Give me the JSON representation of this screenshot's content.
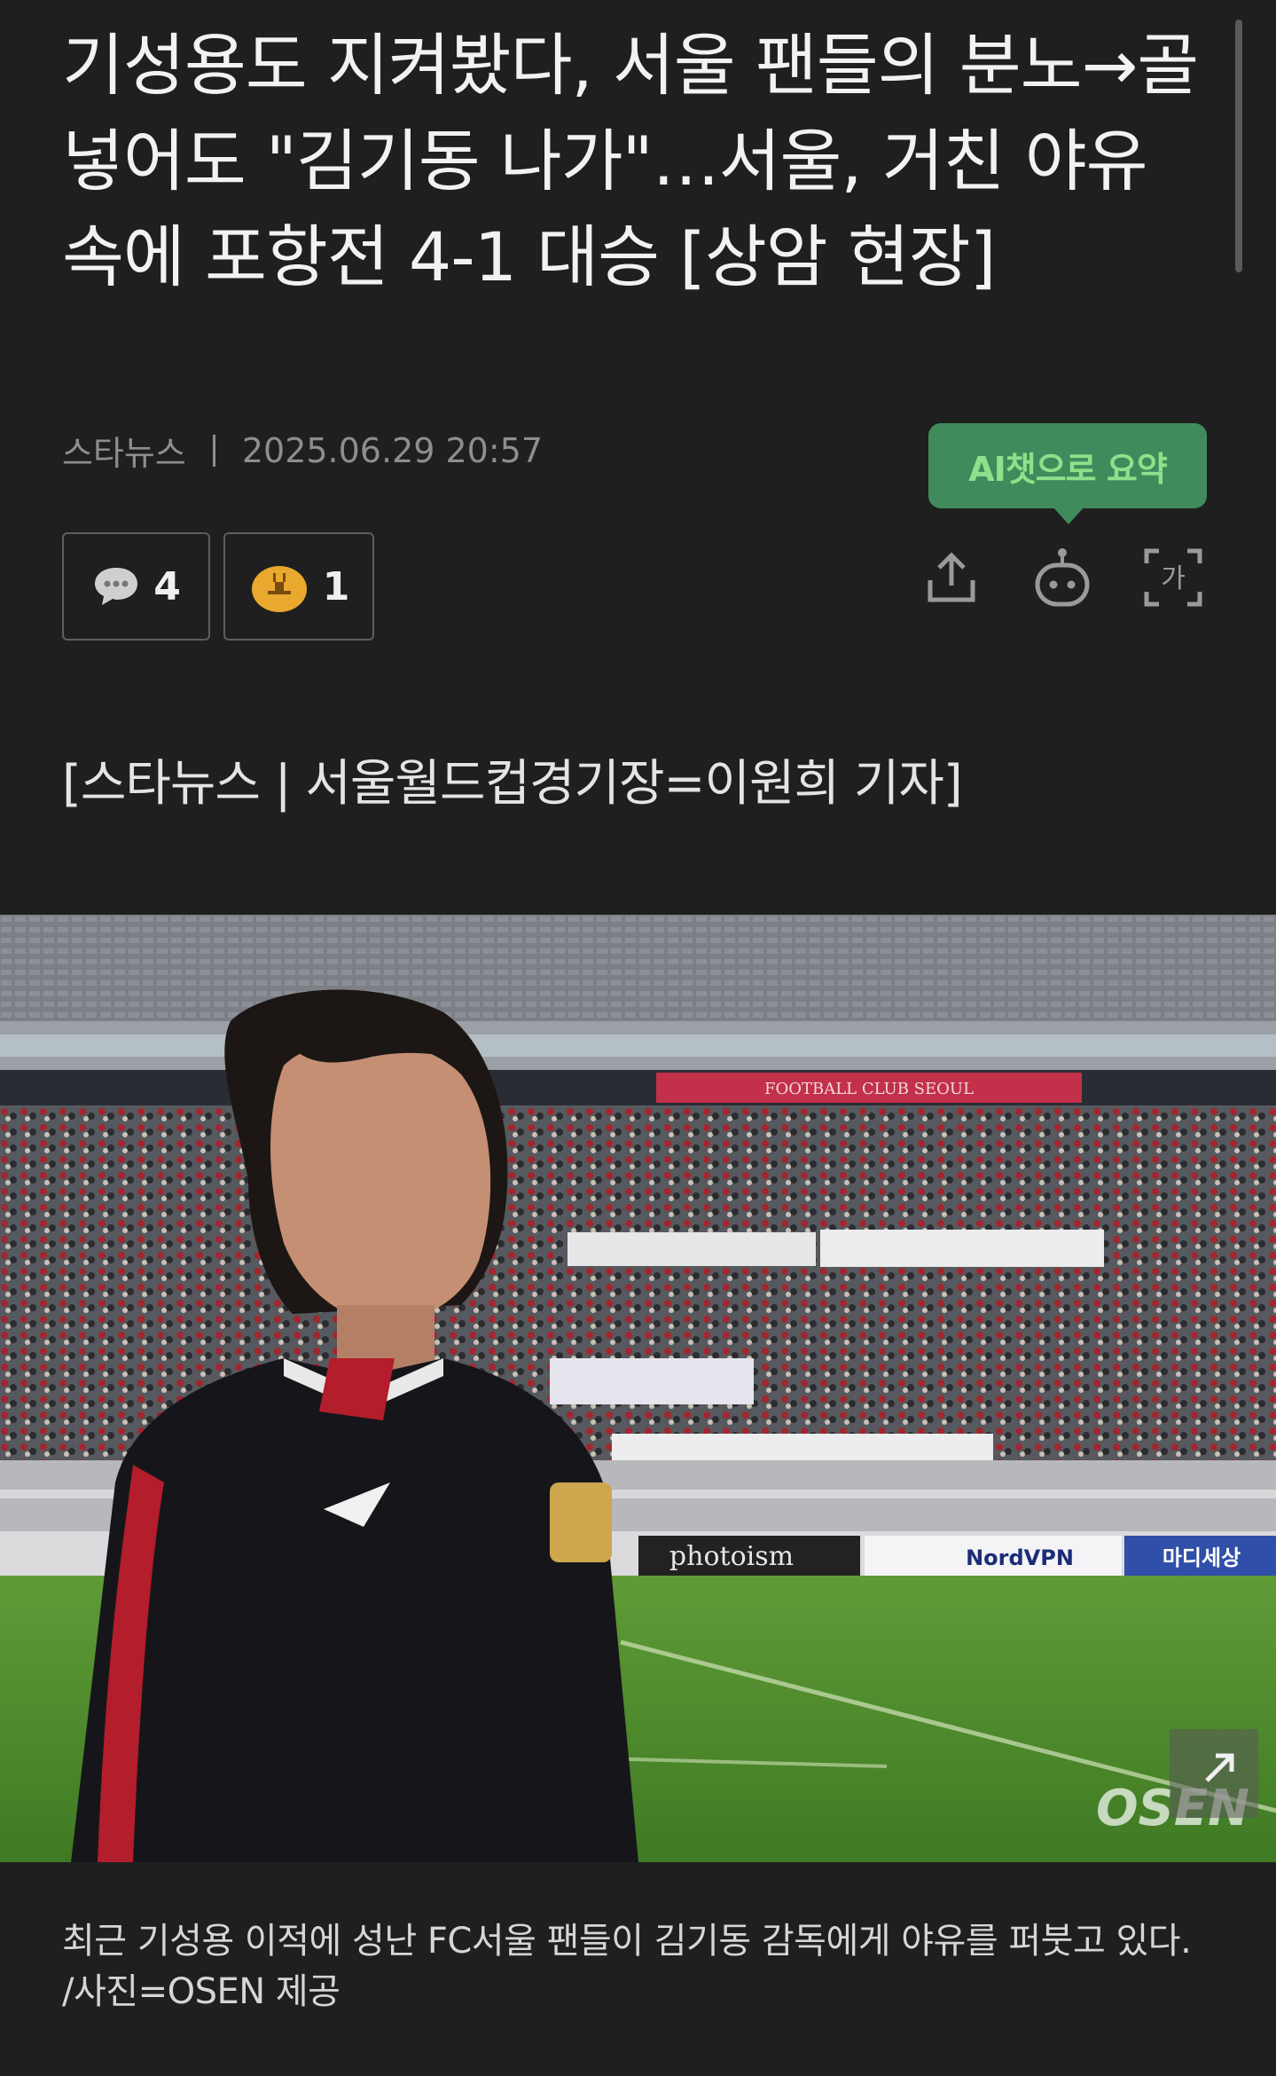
{
  "article": {
    "headline": "기성용도 지켜봤다, 서울 팬들의 분노→골 넣어도 \"김기동 나가\"…서울, 거친 야유 속에 포항전 4-1 대승 [상암 현장]",
    "source": "스타뉴스",
    "datetime": "2025.06.29 20:57",
    "byline": "[스타뉴스 | 서울월드컵경기장=이원희 기자]"
  },
  "ai_summary": {
    "label": "AI챗으로 요약"
  },
  "reactions": {
    "comments_count": "4",
    "reactions_count": "1"
  },
  "toolbar": {
    "share_icon": "share-icon",
    "bot_icon": "ai-bot-icon",
    "font_icon": "font-size-icon",
    "font_glyph": "가"
  },
  "photo": {
    "board_photoism": "photoism",
    "board_nordvpn": "NordVPN",
    "board_third": "마디세상",
    "banner_stand": "FOOTBALL CLUB SEOUL",
    "watermark": "OSEN"
  },
  "caption": {
    "line1": "최근 기성용 이적에 성난 FC서울 팬들이 김기동 감독에게 야유를 퍼붓고 있다.",
    "line2": "/사진=OSEN 제공"
  },
  "colors": {
    "background": "#1f1f1f",
    "ai_tip_bg": "#3f8b5c",
    "ai_tip_text": "#8fe08a",
    "react_icon": "#e9a92f"
  }
}
